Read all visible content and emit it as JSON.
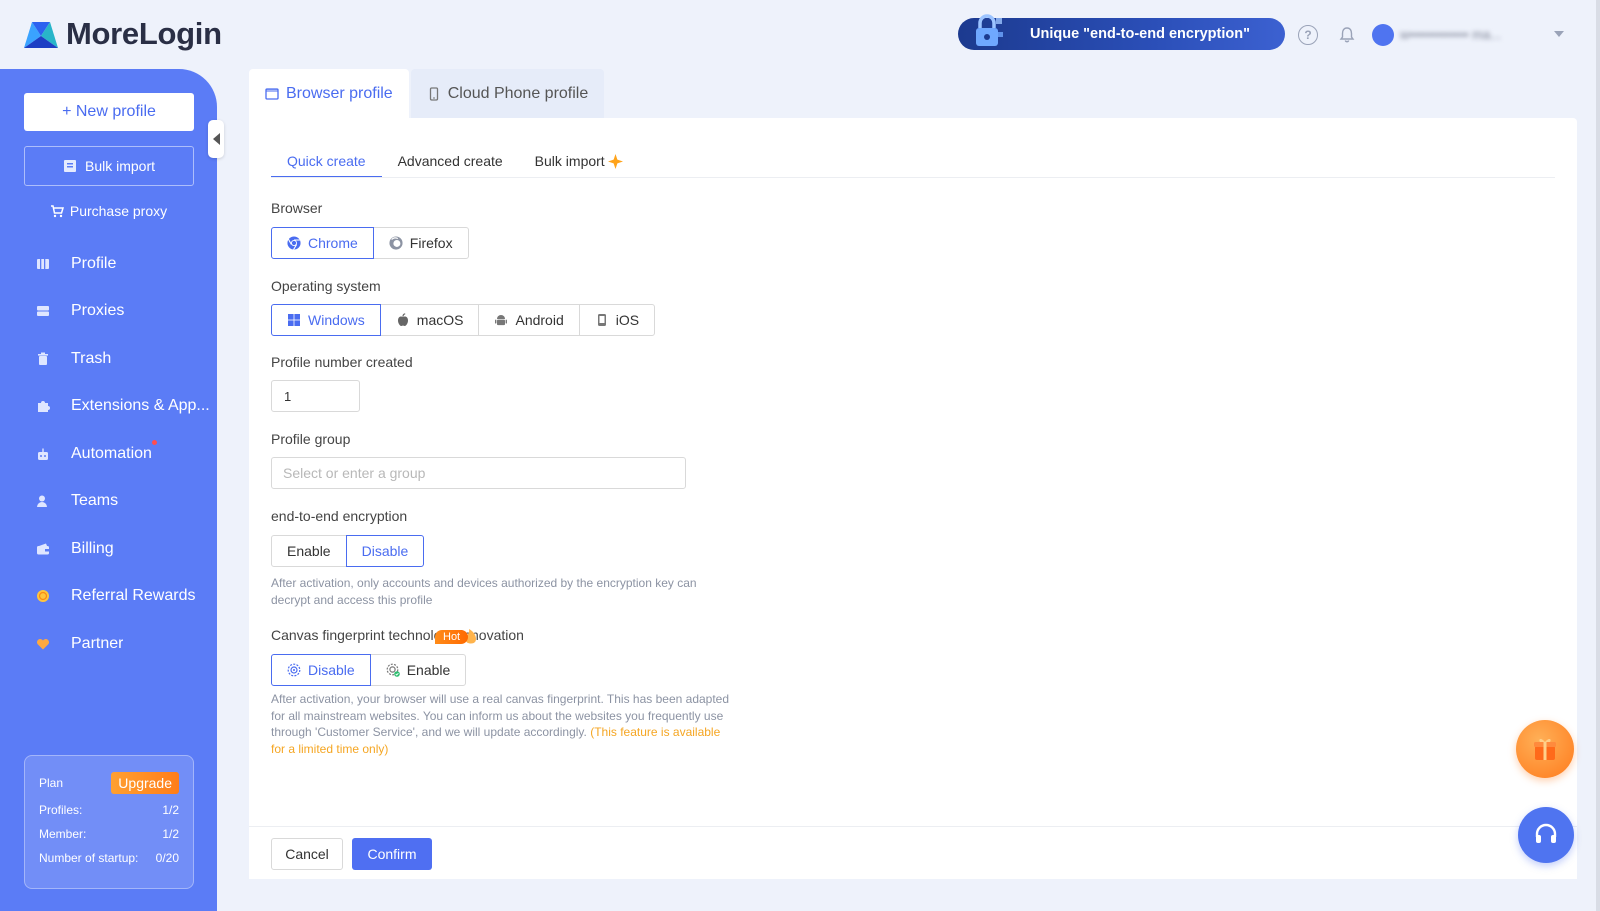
{
  "header": {
    "brand": "MoreLogin",
    "promo_text": "Unique \"end-to-end encryption\"",
    "help_symbol": "?",
    "user_name": "w••••••••••••• ma..."
  },
  "sidebar": {
    "new_profile": "+ New profile",
    "bulk_import": "Bulk import",
    "purchase_proxy": "Purchase proxy",
    "items": [
      {
        "label": "Profile",
        "icon": "profile-icon"
      },
      {
        "label": "Proxies",
        "icon": "proxies-icon"
      },
      {
        "label": "Trash",
        "icon": "trash-icon"
      },
      {
        "label": "Extensions & App...",
        "icon": "extensions-icon"
      },
      {
        "label": "Automation",
        "icon": "automation-icon"
      },
      {
        "label": "Teams",
        "icon": "teams-icon"
      },
      {
        "label": "Billing",
        "icon": "billing-icon"
      },
      {
        "label": "Referral Rewards",
        "icon": "referral-icon"
      },
      {
        "label": "Partner",
        "icon": "partner-icon"
      }
    ],
    "plan": {
      "label": "Plan",
      "upgrade": "Upgrade",
      "profiles_label": "Profiles:",
      "profiles_value": "1/2",
      "member_label": "Member:",
      "member_value": "1/2",
      "startup_label": "Number of startup:",
      "startup_value": "0/20"
    }
  },
  "top_tabs": {
    "browser_profile": "Browser profile",
    "cloud_phone_profile": "Cloud Phone profile"
  },
  "sub_tabs": {
    "quick_create": "Quick create",
    "advanced_create": "Advanced create",
    "bulk_import": "Bulk import"
  },
  "form": {
    "browser_label": "Browser",
    "browser_options": [
      "Chrome",
      "Firefox"
    ],
    "os_label": "Operating system",
    "os_options": [
      "Windows",
      "macOS",
      "Android",
      "iOS"
    ],
    "profile_number_label": "Profile number created",
    "profile_number_value": "1",
    "profile_group_label": "Profile group",
    "profile_group_placeholder": "Select or enter a group",
    "e2e_label": "end-to-end encryption",
    "e2e_enable": "Enable",
    "e2e_disable": "Disable",
    "e2e_hint_line1": "After activation, only accounts and devices authorized by the encryption key can",
    "e2e_hint_line2": "decrypt and access this profile",
    "canvas_label": "Canvas fingerprint technology innovation",
    "canvas_disable": "Disable",
    "canvas_enable": "Enable",
    "hot_badge": "Hot",
    "canvas_hint_line1": "After activation, your browser will use a real canvas fingerprint. This has been adapted",
    "canvas_hint_line2": "for all mainstream websites. You can inform us about the websites you frequently use",
    "canvas_hint_line3": "through 'Customer Service', and we will update accordingly.",
    "canvas_hint_highlight_a": "(This feature is available",
    "canvas_hint_highlight_b": "for a limited time only)"
  },
  "footer": {
    "cancel": "Cancel",
    "confirm": "Confirm"
  },
  "colors": {
    "accent": "#4a6cf0",
    "sidebar": "#5b7cf6",
    "upgrade": "#ff8b19",
    "hint_highlight": "#f5a623"
  }
}
